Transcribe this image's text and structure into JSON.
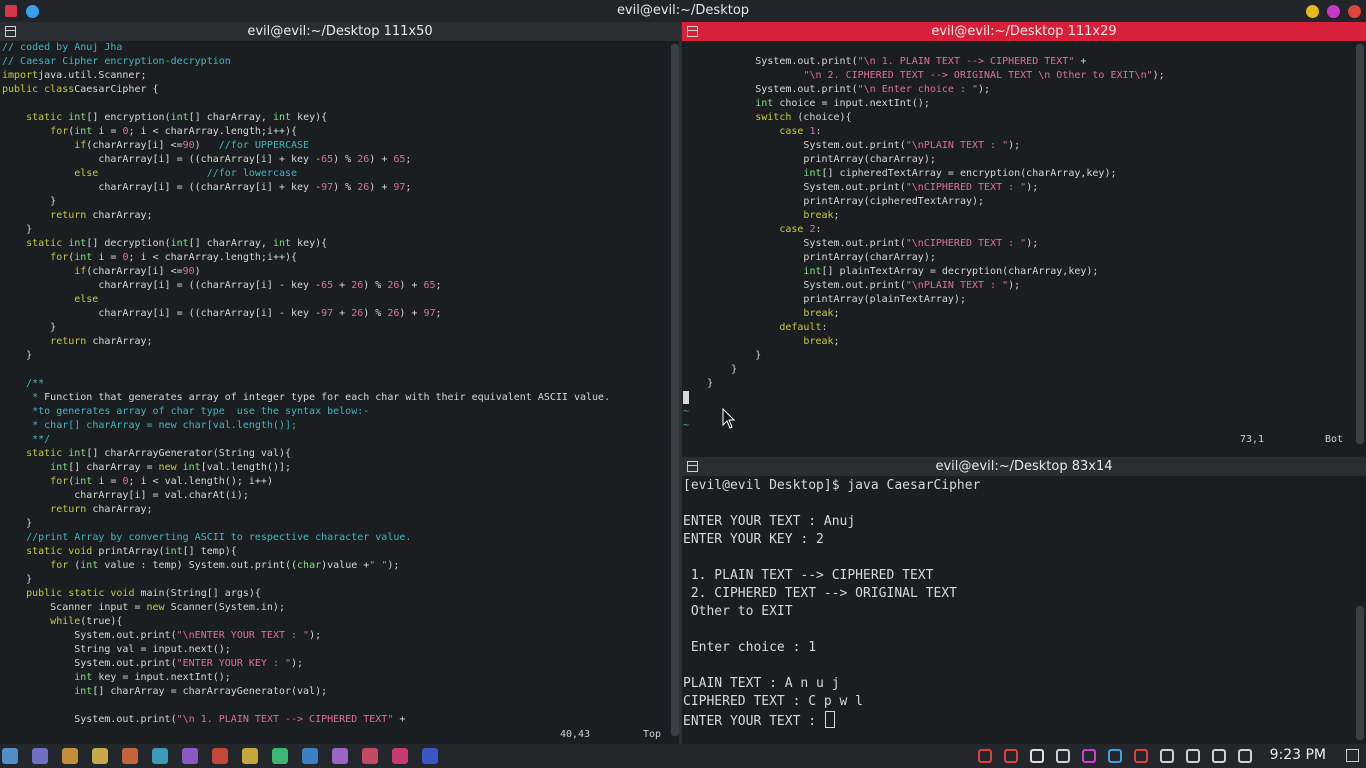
{
  "window": {
    "title": "evil@evil:~/Desktop",
    "colors": {
      "close": "#e0433a",
      "minimize": "#e6b81b",
      "maximize": "#c837c8",
      "other": "#d8344a",
      "blue": "#3aa0f0"
    }
  },
  "left_pane": {
    "title": "evil@evil:~/Desktop 111x50",
    "status_pos": "40,43",
    "status_scroll": "Top",
    "code": [
      [
        [
          "cm",
          "// coded by Anuj Jha"
        ]
      ],
      [
        [
          "cm",
          "// Caesar Cipher encryption-decryption"
        ]
      ],
      [
        [
          "kw",
          "import"
        ],
        [
          "",
          "java.util.Scanner;"
        ]
      ],
      [
        [
          "kw",
          "public class"
        ],
        [
          "",
          "CaesarCipher {"
        ]
      ],
      [
        [
          "",
          ""
        ]
      ],
      [
        [
          "",
          "    "
        ],
        [
          "kw",
          "static"
        ],
        [
          "ty",
          " int"
        ],
        [
          "",
          "[] encryption("
        ],
        [
          "ty",
          "int"
        ],
        [
          "",
          "[] charArray, "
        ],
        [
          "ty",
          "int"
        ],
        [
          "",
          " key){"
        ]
      ],
      [
        [
          "",
          "        "
        ],
        [
          "kw",
          "for"
        ],
        [
          "",
          "("
        ],
        [
          "ty",
          "int"
        ],
        [
          "",
          " i = "
        ],
        [
          "nu",
          "0"
        ],
        [
          "",
          ";"
        ],
        [
          "",
          " i < charArray.length;i++){"
        ]
      ],
      [
        [
          "",
          "            "
        ],
        [
          "kw",
          "if"
        ],
        [
          "",
          "(charArray[i] <="
        ],
        [
          "nu",
          "90"
        ],
        [
          "",
          ")   "
        ],
        [
          "cm",
          "//for UPPERCASE"
        ]
      ],
      [
        [
          "",
          "                charArray[i] = ((charArray[i] + key -"
        ],
        [
          "nu",
          "65"
        ],
        [
          "",
          ") % "
        ],
        [
          "nu",
          "26"
        ],
        [
          "",
          ") + "
        ],
        [
          "nu",
          "65"
        ],
        [
          "",
          ";"
        ]
      ],
      [
        [
          "",
          "            "
        ],
        [
          "kw",
          "else"
        ],
        [
          "",
          "                  "
        ],
        [
          "cm",
          "//for lowercase"
        ]
      ],
      [
        [
          "",
          "                charArray[i] = ((charArray[i] + key -"
        ],
        [
          "nu",
          "97"
        ],
        [
          "",
          ") % "
        ],
        [
          "nu",
          "26"
        ],
        [
          "",
          ") + "
        ],
        [
          "nu",
          "97"
        ],
        [
          "",
          ";"
        ]
      ],
      [
        [
          "",
          "        }"
        ]
      ],
      [
        [
          "",
          "        "
        ],
        [
          "kw",
          "return"
        ],
        [
          "",
          " charArray;"
        ]
      ],
      [
        [
          "",
          "    }"
        ]
      ],
      [
        [
          "",
          "    "
        ],
        [
          "kw",
          "static"
        ],
        [
          "ty",
          " int"
        ],
        [
          "",
          "[] decryption("
        ],
        [
          "ty",
          "int"
        ],
        [
          "",
          "[] charArray, "
        ],
        [
          "ty",
          "int"
        ],
        [
          "",
          " key){"
        ]
      ],
      [
        [
          "",
          "        "
        ],
        [
          "kw",
          "for"
        ],
        [
          "",
          "("
        ],
        [
          "ty",
          "int"
        ],
        [
          "",
          " i = "
        ],
        [
          "nu",
          "0"
        ],
        [
          "",
          ";"
        ],
        [
          "",
          " i < charArray.length;i++){"
        ]
      ],
      [
        [
          "",
          "            "
        ],
        [
          "kw",
          "if"
        ],
        [
          "",
          "(charArray[i] <="
        ],
        [
          "nu",
          "90"
        ],
        [
          "",
          ")"
        ]
      ],
      [
        [
          "",
          "                charArray[i] = ((charArray[i] - key -"
        ],
        [
          "nu",
          "65"
        ],
        [
          "",
          " + "
        ],
        [
          "nu",
          "26"
        ],
        [
          "",
          ") % "
        ],
        [
          "nu",
          "26"
        ],
        [
          "",
          ") + "
        ],
        [
          "nu",
          "65"
        ],
        [
          "",
          ";"
        ]
      ],
      [
        [
          "",
          "            "
        ],
        [
          "kw",
          "else"
        ]
      ],
      [
        [
          "",
          "                charArray[i] = ((charArray[i] - key -"
        ],
        [
          "nu",
          "97"
        ],
        [
          "",
          " + "
        ],
        [
          "nu",
          "26"
        ],
        [
          "",
          ") % "
        ],
        [
          "nu",
          "26"
        ],
        [
          "",
          ") + "
        ],
        [
          "nu",
          "97"
        ],
        [
          "",
          ";"
        ]
      ],
      [
        [
          "",
          "        }"
        ]
      ],
      [
        [
          "",
          "        "
        ],
        [
          "kw",
          "return"
        ],
        [
          "",
          " charArray;"
        ]
      ],
      [
        [
          "",
          "    }"
        ]
      ],
      [
        [
          "",
          ""
        ]
      ],
      [
        [
          "",
          "    "
        ],
        [
          "cm",
          "/**"
        ]
      ],
      [
        [
          "",
          "     "
        ],
        [
          "cm",
          "* "
        ],
        [
          "",
          "Function that generates array of integer type for each char with their equivalent ASCII value."
        ]
      ],
      [
        [
          "",
          "     "
        ],
        [
          "cm",
          "*to generates array of char type  use the syntax below:-"
        ]
      ],
      [
        [
          "",
          "     "
        ],
        [
          "cm",
          "* char[] charArray = new char[val.length()];"
        ]
      ],
      [
        [
          "",
          "     "
        ],
        [
          "cm",
          "**/"
        ]
      ],
      [
        [
          "",
          "    "
        ],
        [
          "kw",
          "static"
        ],
        [
          "ty",
          " int"
        ],
        [
          "",
          "[] charArrayGenerator(String val){"
        ]
      ],
      [
        [
          "",
          "        "
        ],
        [
          "ty",
          "int"
        ],
        [
          "",
          "[] charArray = "
        ],
        [
          "kw",
          "new"
        ],
        [
          "ty",
          " int"
        ],
        [
          "",
          "[val.length()];"
        ]
      ],
      [
        [
          "",
          "        "
        ],
        [
          "kw",
          "for"
        ],
        [
          "",
          "("
        ],
        [
          "ty",
          "int"
        ],
        [
          "",
          " i = "
        ],
        [
          "nu",
          "0"
        ],
        [
          "",
          ";"
        ],
        [
          "",
          " i < val.length(); i++)"
        ]
      ],
      [
        [
          "",
          "            charArray[i] = val.charAt(i);"
        ]
      ],
      [
        [
          "",
          "        "
        ],
        [
          "kw",
          "return"
        ],
        [
          "",
          " charArray;"
        ]
      ],
      [
        [
          "",
          "    }"
        ]
      ],
      [
        [
          "",
          "    "
        ],
        [
          "cm",
          "//print Array by converting ASCII to respective character value."
        ]
      ],
      [
        [
          "",
          "    "
        ],
        [
          "kw",
          "static void"
        ],
        [
          "",
          " printArray("
        ],
        [
          "ty",
          "int"
        ],
        [
          "",
          "[] temp){"
        ]
      ],
      [
        [
          "",
          "        "
        ],
        [
          "kw",
          "for"
        ],
        [
          "",
          " ("
        ],
        [
          "ty",
          "int"
        ],
        [
          "",
          " value : temp) System.out.print(("
        ],
        [
          "ty",
          "char"
        ],
        [
          "",
          ")value +"
        ],
        [
          "st",
          "\" \""
        ],
        [
          "",
          ");"
        ]
      ],
      [
        [
          "",
          "    }"
        ]
      ],
      [
        [
          "",
          "    "
        ],
        [
          "kw",
          "public static void"
        ],
        [
          "",
          " main(String[] args){"
        ]
      ],
      [
        [
          "",
          "        Scanner input = "
        ],
        [
          "kw",
          "new"
        ],
        [
          "",
          " Scanner(System.in);"
        ]
      ],
      [
        [
          "",
          "        "
        ],
        [
          "kw",
          "while"
        ],
        [
          "",
          "(true){"
        ]
      ],
      [
        [
          "",
          "            System.out.print("
        ],
        [
          "st",
          "\"\\nENTER YOUR TEXT : \""
        ],
        [
          "",
          ");"
        ]
      ],
      [
        [
          "",
          "            String val = input.next();"
        ]
      ],
      [
        [
          "",
          "            System.out.print("
        ],
        [
          "st",
          "\"ENTER YOUR KEY : \""
        ],
        [
          "",
          ");"
        ]
      ],
      [
        [
          "",
          "            "
        ],
        [
          "ty",
          "int"
        ],
        [
          "",
          " key = input.nextInt();"
        ]
      ],
      [
        [
          "",
          "            "
        ],
        [
          "ty",
          "int"
        ],
        [
          "",
          "[] charArray = charArrayGenerator(val);"
        ]
      ],
      [
        [
          "",
          ""
        ]
      ],
      [
        [
          "",
          "            System.out.print("
        ],
        [
          "st",
          "\"\\n 1. PLAIN TEXT --> CIPHERED TEXT\""
        ],
        [
          "",
          " +"
        ]
      ]
    ]
  },
  "right_top_pane": {
    "title": "evil@evil:~/Desktop 111x29",
    "status_pos": "73,1",
    "status_scroll": "Bot",
    "code": [
      [
        [
          "",
          "            System.out.print("
        ],
        [
          "st",
          "\"\\n 1. PLAIN TEXT --> CIPHERED TEXT\""
        ],
        [
          "",
          " +"
        ]
      ],
      [
        [
          "",
          "                    "
        ],
        [
          "st",
          "\"\\n 2. CIPHERED TEXT --> ORIGINAL TEXT \\n Other to EXIT\\n\""
        ],
        [
          "",
          ");"
        ]
      ],
      [
        [
          "",
          "            System.out.print("
        ],
        [
          "st",
          "\"\\n Enter choice : \""
        ],
        [
          "",
          ");"
        ]
      ],
      [
        [
          "",
          "            "
        ],
        [
          "ty",
          "int"
        ],
        [
          "",
          " choice = input.nextInt();"
        ]
      ],
      [
        [
          "",
          "            "
        ],
        [
          "kw",
          "switch"
        ],
        [
          "",
          " (choice){"
        ]
      ],
      [
        [
          "",
          "                "
        ],
        [
          "kw",
          "case"
        ],
        [
          "nu",
          " 1"
        ],
        [
          "",
          ":"
        ]
      ],
      [
        [
          "",
          "                    System.out.print("
        ],
        [
          "st",
          "\"\\nPLAIN TEXT : \""
        ],
        [
          "",
          ");"
        ]
      ],
      [
        [
          "",
          "                    printArray(charArray);"
        ]
      ],
      [
        [
          "",
          "                    "
        ],
        [
          "ty",
          "int"
        ],
        [
          "",
          "[] cipheredTextArray = encryption(charArray,key);"
        ]
      ],
      [
        [
          "",
          "                    System.out.print("
        ],
        [
          "st",
          "\"\\nCIPHERED TEXT : \""
        ],
        [
          "",
          ");"
        ]
      ],
      [
        [
          "",
          "                    printArray(cipheredTextArray);"
        ]
      ],
      [
        [
          "",
          "                    "
        ],
        [
          "kw",
          "break"
        ],
        [
          "",
          ";"
        ]
      ],
      [
        [
          "",
          "                "
        ],
        [
          "kw",
          "case"
        ],
        [
          "nu",
          " 2"
        ],
        [
          "",
          ":"
        ]
      ],
      [
        [
          "",
          "                    System.out.print("
        ],
        [
          "st",
          "\"\\nCIPHERED TEXT : \""
        ],
        [
          "",
          ");"
        ]
      ],
      [
        [
          "",
          "                    printArray(charArray);"
        ]
      ],
      [
        [
          "",
          "                    "
        ],
        [
          "ty",
          "int"
        ],
        [
          "",
          "[] plainTextArray = decryption(charArray,key);"
        ]
      ],
      [
        [
          "",
          "                    System.out.print("
        ],
        [
          "st",
          "\"\\nPLAIN TEXT : \""
        ],
        [
          "",
          ");"
        ]
      ],
      [
        [
          "",
          "                    printArray(plainTextArray);"
        ]
      ],
      [
        [
          "",
          "                    "
        ],
        [
          "kw",
          "break"
        ],
        [
          "",
          ";"
        ]
      ],
      [
        [
          "",
          "                "
        ],
        [
          "kw",
          "default"
        ],
        [
          "",
          ":"
        ]
      ],
      [
        [
          "",
          "                    "
        ],
        [
          "kw",
          "break"
        ],
        [
          "",
          ";"
        ]
      ],
      [
        [
          "",
          "            }"
        ]
      ],
      [
        [
          "",
          "        }"
        ]
      ],
      [
        [
          "",
          "    }"
        ]
      ],
      [
        [
          "",
          "}"
        ]
      ],
      [
        [
          "cm",
          "~"
        ]
      ],
      [
        [
          "cm",
          "~"
        ]
      ]
    ]
  },
  "right_bottom_pane": {
    "title": "evil@evil:~/Desktop 83x14",
    "lines": [
      "[evil@evil Desktop]$ java CaesarCipher",
      "",
      "ENTER YOUR TEXT : Anuj",
      "ENTER YOUR KEY : 2",
      "",
      " 1. PLAIN TEXT --> CIPHERED TEXT",
      " 2. CIPHERED TEXT --> ORIGINAL TEXT",
      " Other to EXIT",
      "",
      " Enter choice : 1",
      "",
      "PLAIN TEXT : A n u j",
      "CIPHERED TEXT : C p w l",
      "ENTER YOUR TEXT : "
    ]
  },
  "taskbar": {
    "clock": "9:23 PM",
    "launcher_icons": [
      "grid-icon",
      "desktop-icon",
      "settings-icon",
      "folder-icon",
      "terminal-icon",
      "code-editor-icon",
      "vscode-icon",
      "firefox-icon",
      "app-switcher-icon",
      "spotify-icon",
      "network-tool-icon",
      "search-tool-icon",
      "notes-icon",
      "git-icon",
      "editor-icon"
    ],
    "tray_icons": [
      "calendar-icon",
      "trash-icon",
      "alert-icon",
      "clipboard-icon",
      "shield-app-icon",
      "qbittorrent-icon",
      "security-icon",
      "wifi-icon",
      "battery-icon",
      "volume-icon",
      "chevron-up-icon"
    ]
  }
}
